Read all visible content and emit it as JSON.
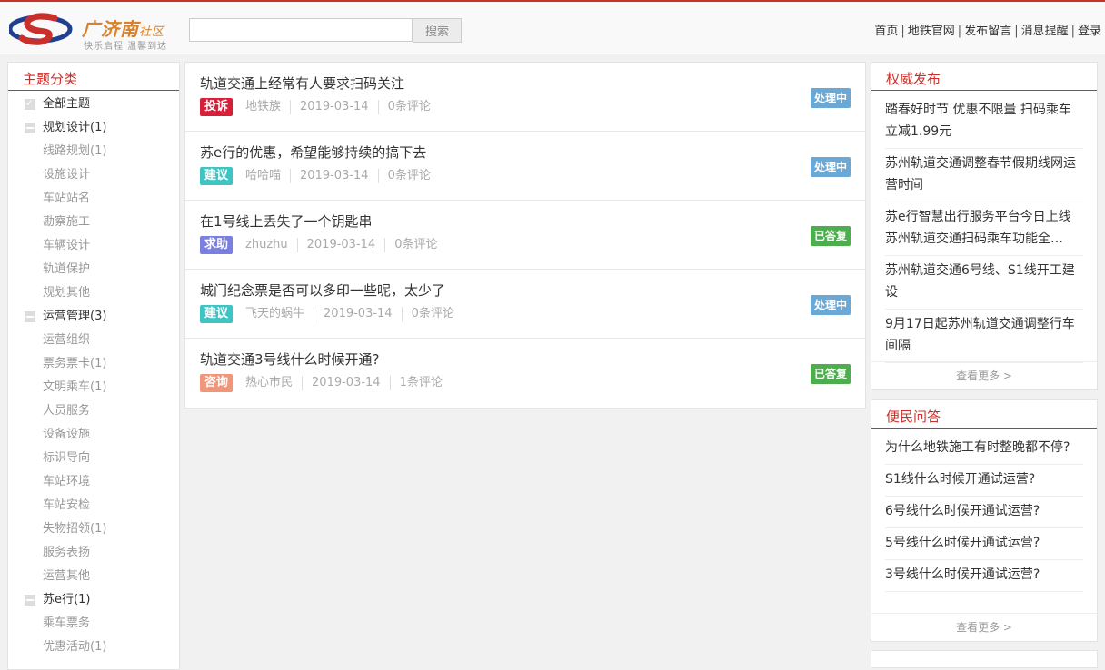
{
  "header": {
    "logo_title": "广济南",
    "logo_title_suffix": "社区",
    "logo_slogan": "快乐启程 温馨到达",
    "search_placeholder": "",
    "search_button": "搜索",
    "nav": [
      "首页",
      "地铁官网",
      "发布留言",
      "消息提醒",
      "登录"
    ]
  },
  "sidebar": {
    "title": "主题分类",
    "items": [
      {
        "label": "全部主题",
        "level": "top",
        "icon": "all"
      },
      {
        "label": "规划设计(1)",
        "level": "top",
        "icon": "minus"
      },
      {
        "label": "线路规划(1)",
        "level": "sub"
      },
      {
        "label": "设施设计",
        "level": "sub"
      },
      {
        "label": "车站站名",
        "level": "sub"
      },
      {
        "label": "勘察施工",
        "level": "sub"
      },
      {
        "label": "车辆设计",
        "level": "sub"
      },
      {
        "label": "轨道保护",
        "level": "sub"
      },
      {
        "label": "规划其他",
        "level": "sub"
      },
      {
        "label": "运营管理(3)",
        "level": "top",
        "icon": "minus"
      },
      {
        "label": "运营组织",
        "level": "sub"
      },
      {
        "label": "票务票卡(1)",
        "level": "sub"
      },
      {
        "label": "文明乘车(1)",
        "level": "sub"
      },
      {
        "label": "人员服务",
        "level": "sub"
      },
      {
        "label": "设备设施",
        "level": "sub"
      },
      {
        "label": "标识导向",
        "level": "sub"
      },
      {
        "label": "车站环境",
        "level": "sub"
      },
      {
        "label": "车站安检",
        "level": "sub"
      },
      {
        "label": "失物招领(1)",
        "level": "sub"
      },
      {
        "label": "服务表扬",
        "level": "sub"
      },
      {
        "label": "运营其他",
        "level": "sub"
      },
      {
        "label": "苏e行(1)",
        "level": "top",
        "icon": "minus"
      },
      {
        "label": "乘车票务",
        "level": "sub"
      },
      {
        "label": "优惠活动(1)",
        "level": "sub"
      }
    ]
  },
  "posts": [
    {
      "title": "轨道交通上经常有人要求扫码关注",
      "tag": "投诉",
      "tag_color": "#d6203a",
      "author": "地铁族",
      "date": "2019-03-14",
      "comments": "0条评论",
      "status": "处理中",
      "status_color": "#6aa8d6"
    },
    {
      "title": "苏e行的优惠，希望能够持续的搞下去",
      "tag": "建议",
      "tag_color": "#3fc4c4",
      "author": "哈哈喵",
      "date": "2019-03-14",
      "comments": "0条评论",
      "status": "处理中",
      "status_color": "#6aa8d6"
    },
    {
      "title": "在1号线上丢失了一个钥匙串",
      "tag": "求助",
      "tag_color": "#7b7fe0",
      "author": "zhuzhu",
      "date": "2019-03-14",
      "comments": "0条评论",
      "status": "已答复",
      "status_color": "#4cae4c"
    },
    {
      "title": "城门纪念票是否可以多印一些呢，太少了",
      "tag": "建议",
      "tag_color": "#3fc4c4",
      "author": "飞天的蜗牛",
      "date": "2019-03-14",
      "comments": "0条评论",
      "status": "处理中",
      "status_color": "#6aa8d6"
    },
    {
      "title": "轨道交通3号线什么时候开通?",
      "tag": "咨询",
      "tag_color": "#f0967a",
      "author": "热心市民",
      "date": "2019-03-14",
      "comments": "1条评论",
      "status": "已答复",
      "status_color": "#4cae4c"
    }
  ],
  "authority": {
    "title": "权威发布",
    "items": [
      "踏春好时节 优惠不限量 扫码乘车立减1.99元",
      "苏州轨道交通调整春节假期线网运营时间",
      "苏e行智慧出行服务平台今日上线苏州轨道交通扫码乘车功能全…",
      "苏州轨道交通6号线、S1线开工建设",
      "9月17日起苏州轨道交通调整行车间隔"
    ],
    "more": "查看更多 >"
  },
  "qa": {
    "title": "便民问答",
    "items": [
      "为什么地铁施工有时整晚都不停?",
      "S1线什么时候开通试运营?",
      "6号线什么时候开通试运营?",
      "5号线什么时候开通试运营?",
      "3号线什么时候开通试运营?"
    ],
    "more": "查看更多 >"
  },
  "colors": {
    "accent": "#c9302c",
    "brand": "#d9822b"
  }
}
